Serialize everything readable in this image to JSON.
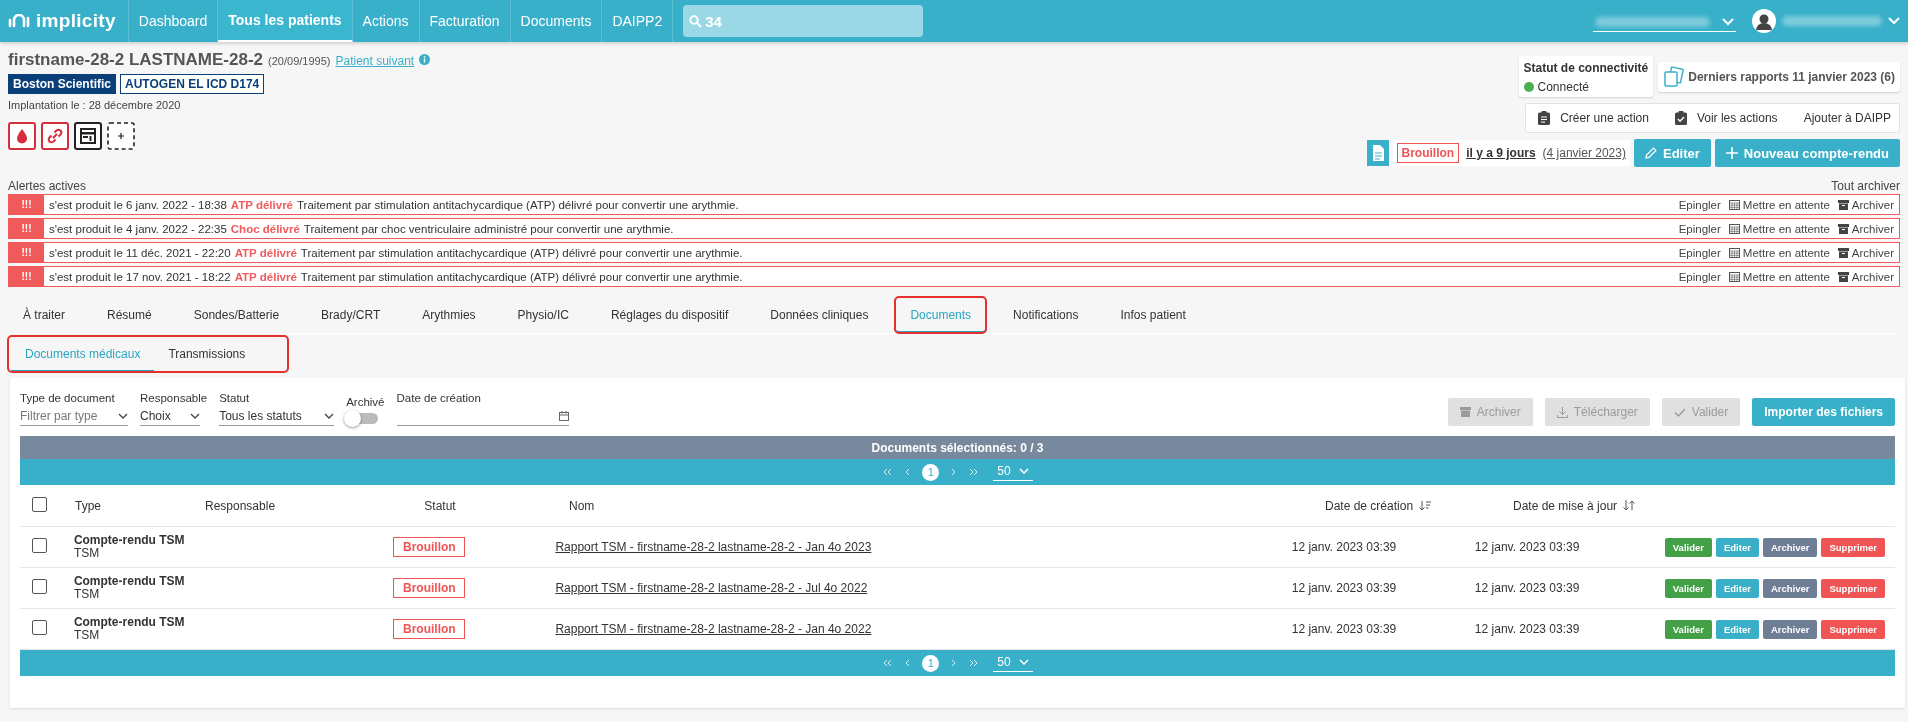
{
  "topbar": {
    "logo": "implicity",
    "nav": [
      {
        "label": "Dashboard",
        "selected": false
      },
      {
        "label": "Tous les patients",
        "selected": true
      },
      {
        "label": "Actions",
        "selected": false
      },
      {
        "label": "Facturation",
        "selected": false
      },
      {
        "label": "Documents",
        "selected": false
      },
      {
        "label": "DAIPP2",
        "selected": false
      }
    ],
    "search": {
      "value": "34"
    }
  },
  "patient": {
    "name": "firstname-28-2 LASTNAME-28-2",
    "birth": "(20/09/1995)",
    "next_link": "Patient suivant",
    "manufacturer": "Boston Scientific",
    "device": "AUTOGEN EL ICD D174",
    "implantation": "Implantation le : 28 décembre 2020"
  },
  "connectivity": {
    "title": "Statut de connectivité",
    "status": "Connecté",
    "connected": true
  },
  "reports": {
    "label": "Derniers rapports 11 janvier 2023 (6)"
  },
  "actions": [
    "Créer une action",
    "Voir les actions",
    "Ajouter à DAIPP"
  ],
  "draft": {
    "status": "Brouillon",
    "ago": "il y a 9 jours",
    "date": "(4 janvier 2023)"
  },
  "header_buttons": [
    "Editer",
    "Nouveau compte-rendu"
  ],
  "alerts": {
    "title": "Alertes actives",
    "archive_all": "Tout archiver",
    "items": [
      {
        "marker": "!!!",
        "occurred": "s'est produit le 6 janv. 2022 - 18:38",
        "label": "ATP délivré",
        "description": "Traitement par stimulation antitachycardique (ATP) délivré pour convertir une arythmie.",
        "actions": [
          "Epingler",
          "Mettre en attente",
          "Archiver"
        ]
      },
      {
        "marker": "!!!",
        "occurred": "s'est produit le 4 janv. 2022 - 22:35",
        "label": "Choc délivré",
        "description": "Traitement par choc ventriculaire administré pour convertir une arythmie.",
        "actions": [
          "Epingler",
          "Mettre en attente",
          "Archiver"
        ]
      },
      {
        "marker": "!!!",
        "occurred": "s'est produit le 11 déc. 2021 - 22:20",
        "label": "ATP délivré",
        "description": "Traitement par stimulation antitachycardique (ATP) délivré pour convertir une arythmie.",
        "actions": [
          "Epingler",
          "Mettre en attente",
          "Archiver"
        ]
      },
      {
        "marker": "!!!",
        "occurred": "s'est produit le 17 nov. 2021 - 18:22",
        "label": "ATP délivré",
        "description": "Traitement par stimulation antitachycardique (ATP) délivré pour convertir une arythmie.",
        "actions": [
          "Epingler",
          "Mettre en attente",
          "Archiver"
        ]
      }
    ]
  },
  "tabs": [
    {
      "label": "À traiter",
      "selected": false,
      "highlighted": false
    },
    {
      "label": "Résumé",
      "selected": false,
      "highlighted": false
    },
    {
      "label": "Sondes/Batterie",
      "selected": false,
      "highlighted": false
    },
    {
      "label": "Brady/CRT",
      "selected": false,
      "highlighted": false
    },
    {
      "label": "Arythmies",
      "selected": false,
      "highlighted": false
    },
    {
      "label": "Physio/IC",
      "selected": false,
      "highlighted": false
    },
    {
      "label": "Réglages du dispositif",
      "selected": false,
      "highlighted": false
    },
    {
      "label": "Données cliniques",
      "selected": false,
      "highlighted": false
    },
    {
      "label": "Documents",
      "selected": true,
      "highlighted": true
    },
    {
      "label": "Notifications",
      "selected": false,
      "highlighted": false
    },
    {
      "label": "Infos patient",
      "selected": false,
      "highlighted": false
    }
  ],
  "subtabs": {
    "highlighted": true,
    "items": [
      {
        "label": "Documents médicaux",
        "selected": true
      },
      {
        "label": "Transmissions",
        "selected": false
      }
    ]
  },
  "filters": {
    "type": {
      "label": "Type de document",
      "placeholder": "Filtrer par type"
    },
    "responsable": {
      "label": "Responsable",
      "value": "Choix"
    },
    "statut": {
      "label": "Statut",
      "value": "Tous les statuts"
    },
    "archived": {
      "label": "Archivé",
      "on": false
    },
    "date": {
      "label": "Date de création"
    }
  },
  "toolbar": [
    {
      "label": "Archiver",
      "kind": "archive",
      "disabled": true
    },
    {
      "label": "Télécharger",
      "kind": "download",
      "disabled": true
    },
    {
      "label": "Valider",
      "kind": "check",
      "disabled": true
    },
    {
      "label": "Importer des fichiers",
      "kind": "plain",
      "disabled": false
    }
  ],
  "selection": "Documents sélectionnés: 0 / 3",
  "pager_top": {
    "page": "1",
    "per_page": "50"
  },
  "pager_bottom": {
    "page": "1",
    "per_page": "50"
  },
  "table": {
    "select_all": {
      "checked": false
    },
    "columns": [
      {
        "label": "Type",
        "kind": "plain"
      },
      {
        "label": "Responsable",
        "kind": "plain"
      },
      {
        "label": "Statut",
        "kind": "plain"
      },
      {
        "label": "Nom",
        "kind": "plain"
      },
      {
        "label": "Date de création",
        "kind": "sort-desc"
      },
      {
        "label": "Date de mise à jour",
        "kind": "sort-both"
      }
    ],
    "rows": [
      {
        "checked": false,
        "type": "Compte-rendu TSM",
        "subtype": "TSM",
        "status": "Brouillon",
        "name": "Rapport TSM - firstname-28-2 lastname-28-2 - Jan 4o 2023",
        "created": "12 janv. 2023 03:39",
        "updated": "12 janv. 2023 03:39",
        "actions": [
          {
            "label": "Valider",
            "kind": "success"
          },
          {
            "label": "Editer",
            "kind": "info"
          },
          {
            "label": "Archiver",
            "kind": "muted"
          },
          {
            "label": "Supprimer",
            "kind": "danger"
          }
        ]
      },
      {
        "checked": false,
        "type": "Compte-rendu TSM",
        "subtype": "TSM",
        "status": "Brouillon",
        "name": "Rapport TSM - firstname-28-2 lastname-28-2 - Jul 4o 2022",
        "created": "12 janv. 2023 03:39",
        "updated": "12 janv. 2023 03:39",
        "actions": [
          {
            "label": "Valider",
            "kind": "success"
          },
          {
            "label": "Editer",
            "kind": "info"
          },
          {
            "label": "Archiver",
            "kind": "muted"
          },
          {
            "label": "Supprimer",
            "kind": "danger"
          }
        ]
      },
      {
        "checked": false,
        "type": "Compte-rendu TSM",
        "subtype": "TSM",
        "status": "Brouillon",
        "name": "Rapport TSM - firstname-28-2 lastname-28-2 - Jan 4o 2022",
        "created": "12 janv. 2023 03:39",
        "updated": "12 janv. 2023 03:39",
        "actions": [
          {
            "label": "Valider",
            "kind": "success"
          },
          {
            "label": "Editer",
            "kind": "info"
          },
          {
            "label": "Archiver",
            "kind": "muted"
          },
          {
            "label": "Supprimer",
            "kind": "danger"
          }
        ]
      }
    ]
  }
}
